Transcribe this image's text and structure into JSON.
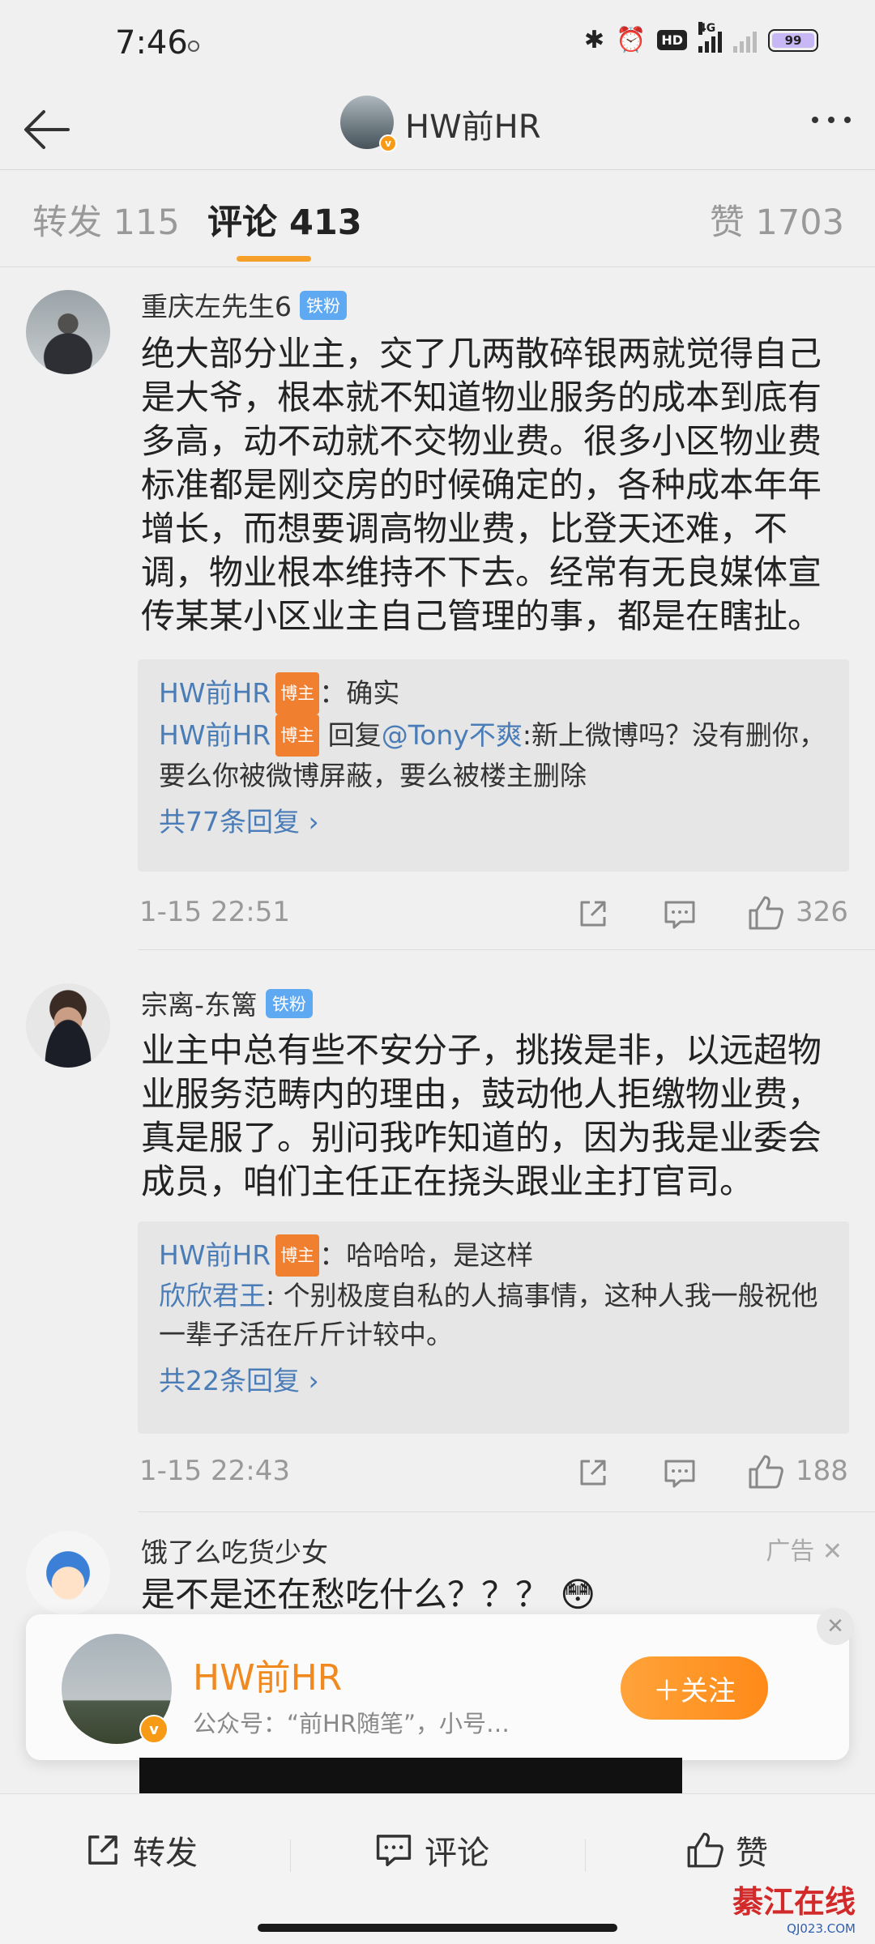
{
  "status_bar": {
    "time": "7:46",
    "network": "4G",
    "battery": "99"
  },
  "nav": {
    "title": "HW前HR"
  },
  "tabs": {
    "repost": "转发 115",
    "comment": "评论 413",
    "like": "赞 1703"
  },
  "badges": {
    "fan": "铁粉",
    "host": "博主",
    "verified": "v"
  },
  "comments": [
    {
      "author": "重庆左先生6",
      "text": "绝大部分业主，交了几两散碎银两就觉得自己是大爷，根本就不知道物业服务的成本到底有多高，动不动就不交物业费。很多小区物业费标准都是刚交房的时候确定的，各种成本年年增长，而想要调高物业费，比登天还难，不调，物业根本维持不下去。经常有无良媒体宣传某某小区业主自己管理的事，都是在瞎扯。",
      "replies": [
        {
          "name": "HW前HR",
          "pre": "",
          "mention": "",
          "text": "：确实"
        },
        {
          "name": "HW前HR",
          "pre": " 回复",
          "mention": "@Tony不爽",
          "text": ":新上微博吗？没有删你，要么你被微博屏蔽，要么被楼主删除"
        }
      ],
      "more_replies": "共77条回复 ›",
      "time": "1-15 22:51",
      "likes": "326"
    },
    {
      "author": "宗离-东篱",
      "text": "业主中总有些不安分子，挑拨是非，以远超物业服务范畴内的理由，鼓动他人拒缴物业费，真是服了。别问我咋知道的，因为我是业委会成员，咱们主任正在挠头跟业主打官司。",
      "replies": [
        {
          "name": "HW前HR",
          "text": "：哈哈哈，是这样"
        },
        {
          "name": "欣欣君王",
          "text": ": 个别极度自私的人搞事情，这种人我一般祝他一辈子活在斤斤计较中。"
        }
      ],
      "more_replies": "共22条回复 ›",
      "time": "1-15 22:43",
      "likes": "188"
    }
  ],
  "ad": {
    "author": "饿了么吃货少女",
    "tag": "广告 ✕",
    "text": "是不是还在愁吃什么？？？ 😳"
  },
  "follow_card": {
    "name": "HW前HR",
    "desc": "公众号：“前HR随笔”，小号…",
    "button": "＋关注",
    "close": "✕"
  },
  "bottom_bar": {
    "repost": "转发",
    "comment": "评论",
    "like": "赞"
  },
  "watermark": {
    "title": "綦江在线",
    "url": "QJ023.COM"
  },
  "colors": {
    "accent": "#f6a02a",
    "link": "#4a7cb8",
    "host_badge": "#f08030",
    "fan_badge": "#5ea9f2"
  }
}
